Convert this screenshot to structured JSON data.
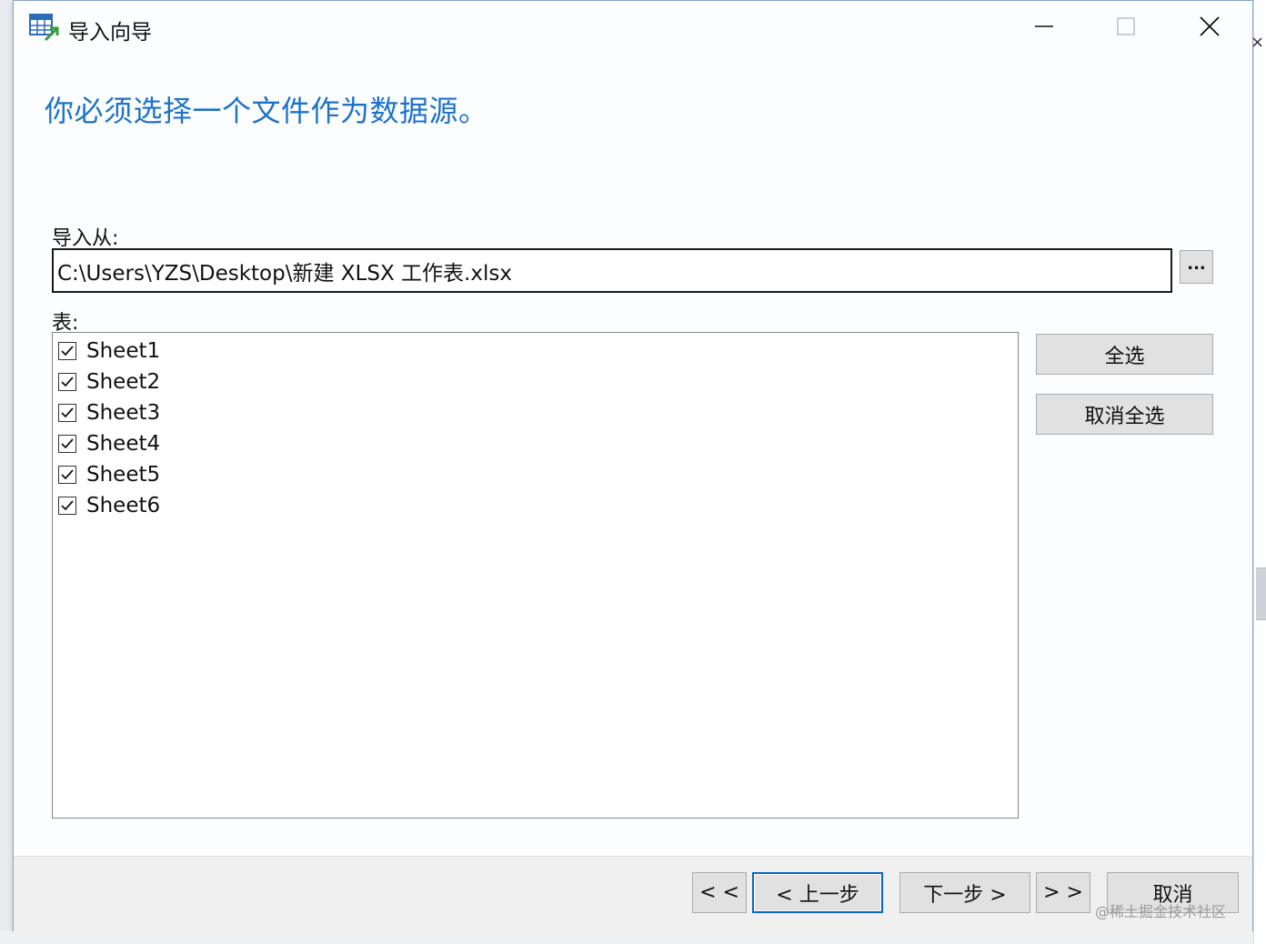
{
  "window": {
    "title": "导入向导",
    "icon": "table-import-icon",
    "controls": {
      "minimize": "minimize-icon",
      "maximize": "maximize-icon",
      "close": "close-icon"
    }
  },
  "heading": "你必须选择一个文件作为数据源。",
  "import_from": {
    "label": "导入从:",
    "value": "C:\\Users\\YZS\\Desktop\\新建 XLSX 工作表.xlsx",
    "browse_label": "..."
  },
  "tables": {
    "label": "表:",
    "items": [
      {
        "label": "Sheet1",
        "checked": true
      },
      {
        "label": "Sheet2",
        "checked": true
      },
      {
        "label": "Sheet3",
        "checked": true
      },
      {
        "label": "Sheet4",
        "checked": true
      },
      {
        "label": "Sheet5",
        "checked": true
      },
      {
        "label": "Sheet6",
        "checked": true
      }
    ],
    "select_all_label": "全选",
    "deselect_all_label": "取消全选"
  },
  "footer": {
    "first_label": "< <",
    "back_label": "< 上一步",
    "next_label": "下一步 >",
    "last_label": "> >",
    "cancel_label": "取消"
  },
  "watermark": "@稀土掘金技术社区",
  "colors": {
    "heading": "#1e73c8",
    "focus_border": "#0a64c8",
    "button_face": "#e1e1e1"
  }
}
